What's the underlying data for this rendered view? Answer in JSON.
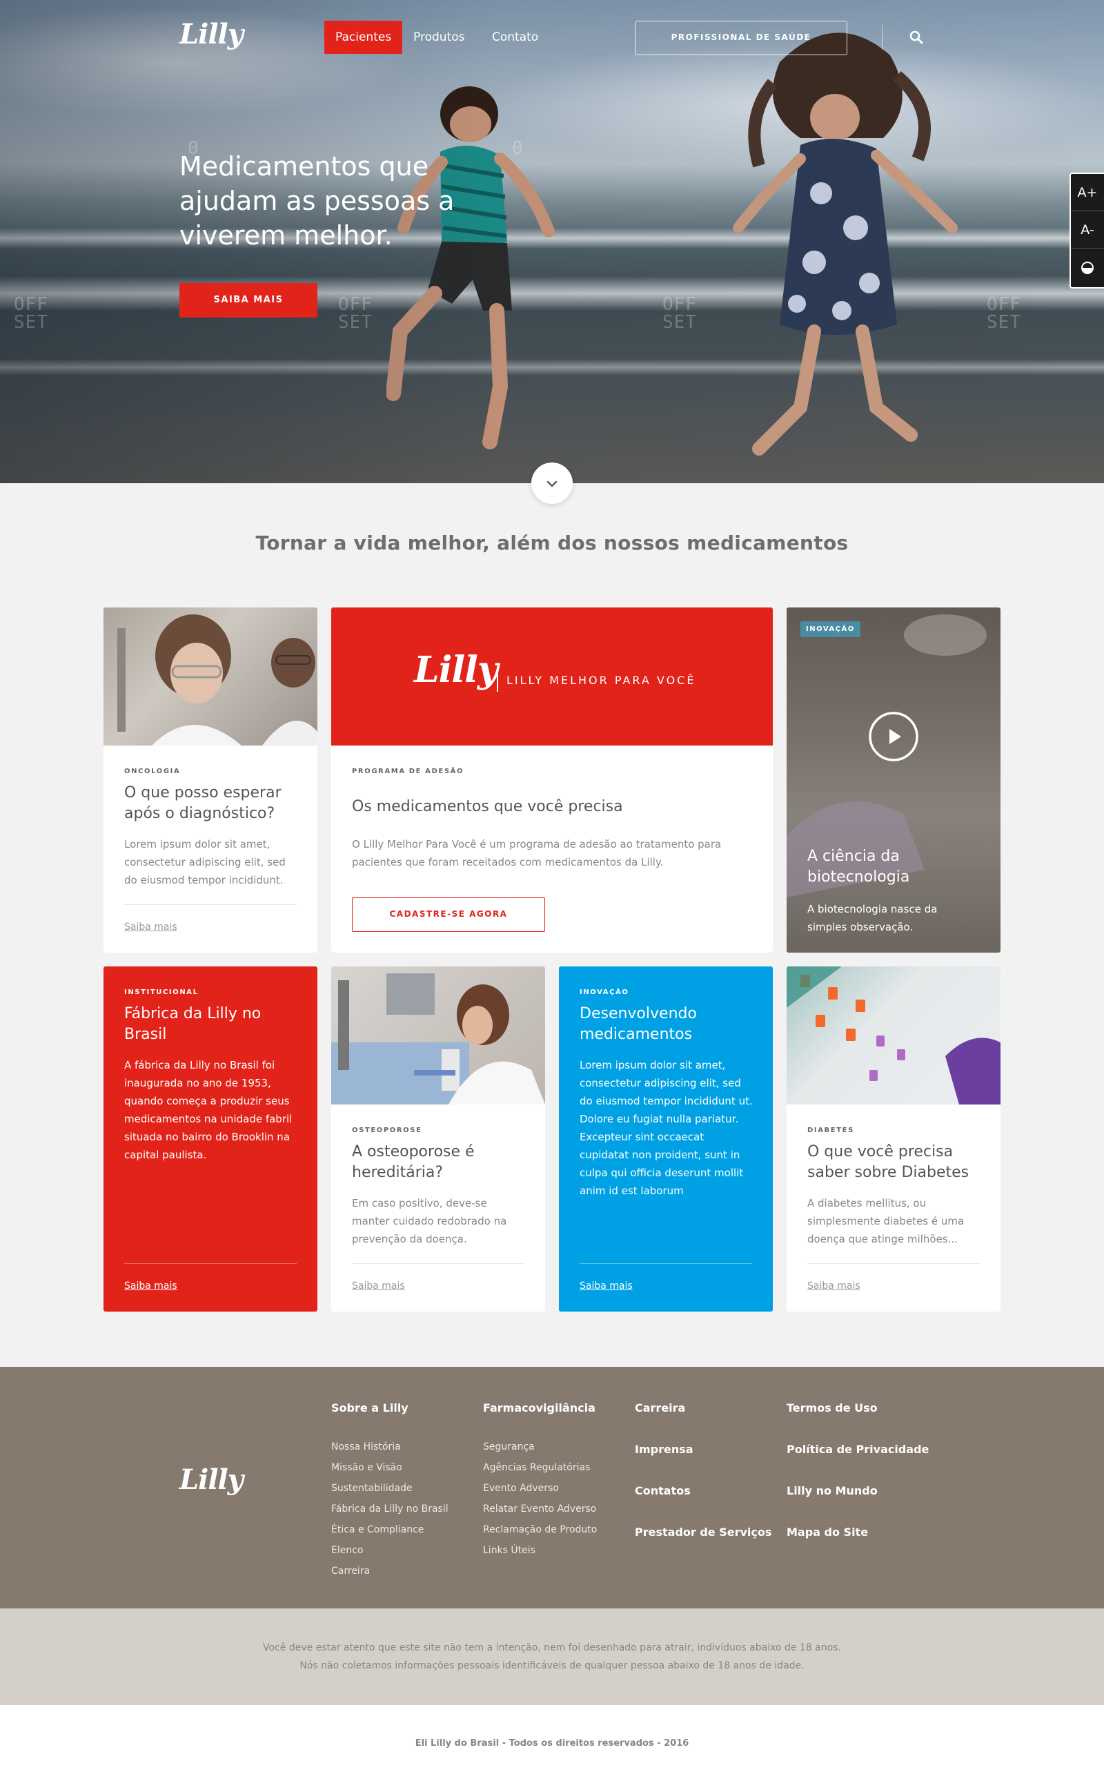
{
  "brand": {
    "logo": "Lilly"
  },
  "nav": {
    "items": [
      {
        "label": "Pacientes",
        "active": true
      },
      {
        "label": "Produtos",
        "active": false
      },
      {
        "label": "Contato",
        "active": false
      }
    ],
    "professional_button": "PROFISSIONAL DE SAÚDE",
    "search_icon": "search-icon"
  },
  "accessibility": {
    "increase_font": "A+",
    "decrease_font": "A-",
    "contrast_icon": "contrast-icon"
  },
  "hero": {
    "title": "Medicamentos que ajudam as pessoas a viverem melhor.",
    "cta": "SAIBA MAIS",
    "watermark_off": "OFF",
    "watermark_set": "SET",
    "watermark_zero": "0",
    "scroll_icon": "chevron-down-icon"
  },
  "section": {
    "title": "Tornar a vida melhor, além dos nossos medicamentos"
  },
  "cards": {
    "oncologia": {
      "eyebrow": "ONCOLOGIA",
      "title": "O que posso esperar após o diagnóstico?",
      "desc": "Lorem ipsum dolor sit amet, consectetur adipiscing elit, sed do eiusmod tempor incididunt.",
      "more": "Saiba mais"
    },
    "adesao": {
      "banner_logo": "Lilly",
      "banner_text": "LILLY MELHOR PARA VOCÊ",
      "eyebrow": "PROGRAMA DE ADESÃO",
      "title": "Os medicamentos que você precisa",
      "desc": "O Lilly Melhor Para Você é um programa de adesão ao tratamento para pacientes que foram receitados com medicamentos da Lilly.",
      "button": "CADASTRE-SE AGORA"
    },
    "biotec": {
      "badge": "INOVAÇÃO",
      "title": "A ciência da biotecnologia",
      "desc": "A biotecnologia nasce da simples observação.",
      "play_icon": "play-icon"
    },
    "fabrica": {
      "eyebrow": "INSTITUCIONAL",
      "title": "Fábrica da Lilly no Brasil",
      "desc": "A fábrica da Lilly no Brasil foi inaugurada no ano de 1953, quando começa a produzir seus medicamentos na unidade fabril situada no bairro do Brooklin na capital paulista.",
      "more": "Saiba mais"
    },
    "osteoporose": {
      "eyebrow": "OSTEOPOROSE",
      "title": "A osteoporose é hereditária?",
      "desc": "Em caso positivo, deve-se manter cuidado redobrado na prevenção da doença.",
      "more": "Saiba mais"
    },
    "desenvolvendo": {
      "eyebrow": "INOVAÇÃO",
      "title": "Desenvolvendo medicamentos",
      "desc": "Lorem ipsum dolor sit amet, consectetur adipiscing elit, sed do eiusmod tempor incididunt ut. Dolore eu fugiat nulla pariatur. Excepteur sint occaecat cupidatat non proident, sunt in culpa qui officia deserunt mollit anim id est laborum",
      "more": "Saiba mais"
    },
    "diabetes": {
      "eyebrow": "DIABETES",
      "title": "O que você precisa saber sobre Diabetes",
      "desc": "A diabetes mellitus, ou simplesmente diabetes é uma doença que atinge milhões...",
      "more": "Saiba mais"
    }
  },
  "footer": {
    "logo": "Lilly",
    "col1": {
      "head": "Sobre a Lilly",
      "links": [
        "Nossa História",
        "Missão e Visão",
        "Sustentabilidade",
        "Fábrica da Lilly no Brasil",
        "Ética e Compliance",
        "Elenco",
        "Carreira"
      ]
    },
    "col2": {
      "head": "Farmacovigilância",
      "links": [
        "Segurança",
        "Agências Regulatórias",
        "Evento Adverso",
        "Relatar Evento Adverso",
        "Reclamação de Produto",
        "Links Úteis"
      ]
    },
    "col3": {
      "links": [
        "Carreira",
        "Imprensa",
        "Contatos",
        "Prestador de Serviços"
      ]
    },
    "col4": {
      "links": [
        "Termos de Uso",
        "Política de Privacidade",
        "Lilly no Mundo",
        "Mapa do Site"
      ]
    }
  },
  "disclaimer": {
    "line1": "Você deve estar atento que este site não tem a intenção, nem foi desenhado para atrair, indivíduos abaixo de 18 anos.",
    "line2": "Nós não coletamos informações pessoais identificáveis de qualquer pessoa abaixo de 18 anos de idade."
  },
  "copyright": "Eli Lilly do Brasil - Todos os direitos reservados - 2016",
  "colors": {
    "brand_red": "#e2231a",
    "brand_blue": "#00a1e4",
    "footer_brown": "#867a6f",
    "disclaimer_bg": "#d4d0c9",
    "badge_teal": "#4a8ca3"
  }
}
